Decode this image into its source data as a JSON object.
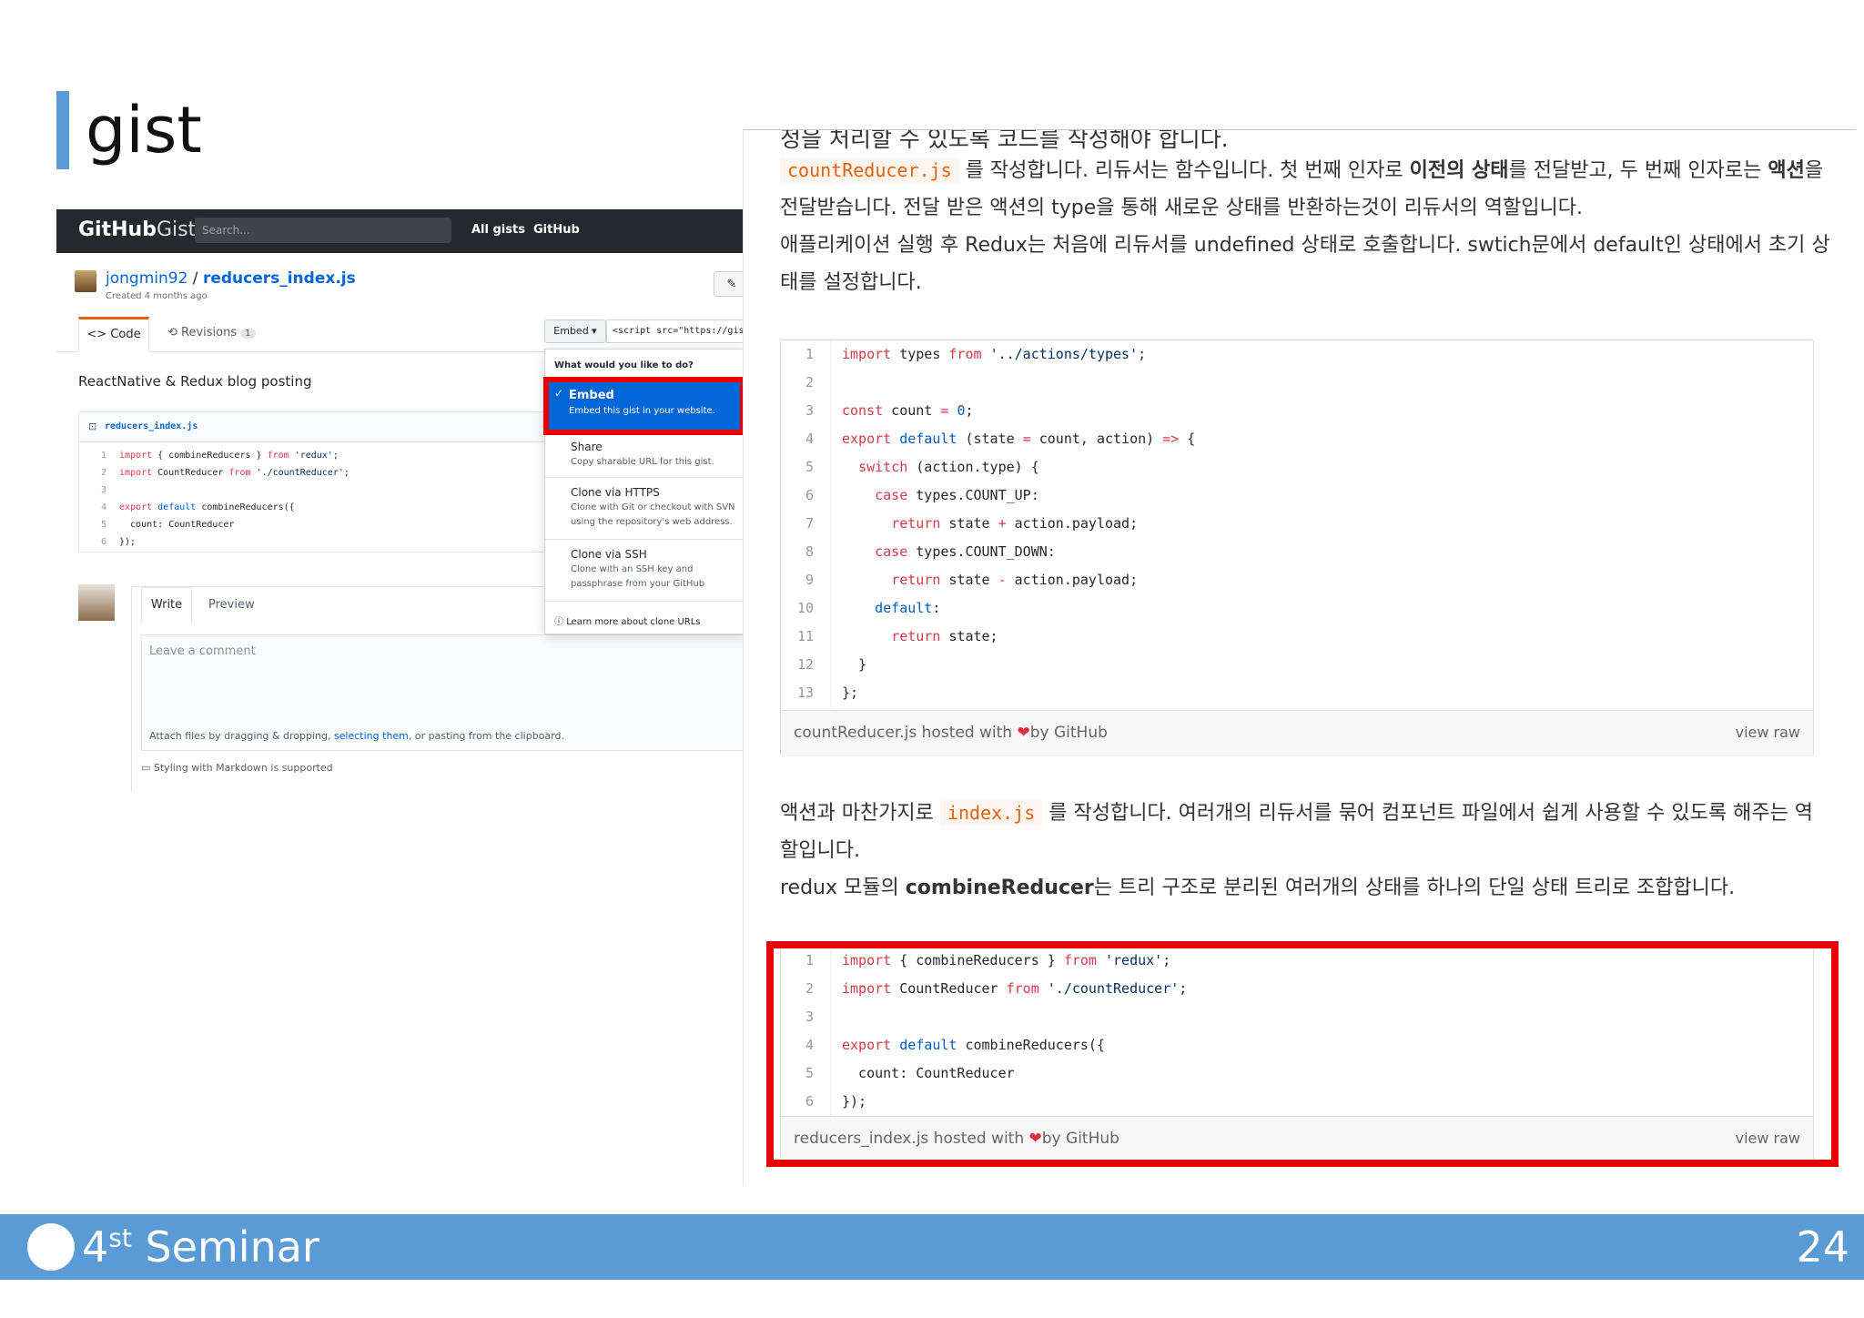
{
  "slide": {
    "title": "gist",
    "footer_label": "Seminar",
    "footer_num": "4",
    "footer_sup": "st",
    "page_number": "24"
  },
  "gist": {
    "logo_bold": "GitHub",
    "logo_light": "Gist",
    "search_placeholder": "Search...",
    "nav": [
      "All gists",
      "GitHub"
    ],
    "owner": "jongmin92",
    "separator": " / ",
    "file_title": "reducers_index.js",
    "created": "Created 4 months ago",
    "tab_code": "<> Code",
    "tab_revisions": "Revisions",
    "revision_count": "1",
    "embed_button": "Embed ▾",
    "embed_url": "<script src=\"https://gist",
    "description": "ReactNative & Redux blog posting",
    "file_name": "reducers_index.js",
    "snippet": [
      {
        "n": "1",
        "t": "import { combineReducers } from 'redux';"
      },
      {
        "n": "2",
        "t": "import CountReducer from './countReducer';"
      },
      {
        "n": "3",
        "t": ""
      },
      {
        "n": "4",
        "t": "export default combineReducers({"
      },
      {
        "n": "5",
        "t": "  count: CountReducer"
      },
      {
        "n": "6",
        "t": "});"
      }
    ],
    "comment": {
      "tab_write": "Write",
      "tab_preview": "Preview",
      "placeholder": "Leave a comment",
      "attach_pre": "Attach files by dragging & dropping, ",
      "attach_link": "selecting them",
      "attach_post": ", or pasting from the clipboard.",
      "markdown": "Styling with Markdown is supported"
    },
    "dropdown": {
      "header": "What would you like to do?",
      "embed_title": "Embed",
      "embed_desc": "Embed this gist in your website.",
      "share_title": "Share",
      "share_desc": "Copy sharable URL for this gist.",
      "https_title": "Clone via HTTPS",
      "https_desc": "Clone with Git or checkout with SVN using the repository's web address.",
      "ssh_title": "Clone via SSH",
      "ssh_desc": "Clone with an SSH key and passphrase from your GitHub settings.",
      "learn": "Learn more about clone URLs"
    }
  },
  "blog": {
    "cut_line": "정을 처리할 수 있도록 코드를 작성해야 합니다.",
    "p1_code": "countReducer.js",
    "p1_a": " 를 작성합니다. 리듀서는 함수입니다. 첫 번째 인자로 ",
    "p1_b": "이전의 상태",
    "p1_c": "를 전달받고, 두 번째 인자로는 ",
    "p1_d": "액션",
    "p1_e": "을",
    "p2": "전달받습니다. 전달 받은 액션의 type을 통해 새로운 상태를 반환하는것이 리듀서의 역할입니다.",
    "p3": "애플리케이션 실행 후 Redux는 처음에 리듀서를 undefined 상태로 호출합니다. swtich문에서 default인 상태에서 초기 상",
    "p4": "태를 설정합니다.",
    "code1": [
      {
        "n": "1",
        "t": "import types from '../actions/types';"
      },
      {
        "n": "2",
        "t": ""
      },
      {
        "n": "3",
        "t": "const count = 0;"
      },
      {
        "n": "4",
        "t": "export default (state = count, action) => {"
      },
      {
        "n": "5",
        "t": "  switch (action.type) {"
      },
      {
        "n": "6",
        "t": "    case types.COUNT_UP:"
      },
      {
        "n": "7",
        "t": "      return state + action.payload;"
      },
      {
        "n": "8",
        "t": "    case types.COUNT_DOWN:"
      },
      {
        "n": "9",
        "t": "      return state - action.payload;"
      },
      {
        "n": "10",
        "t": "    default:"
      },
      {
        "n": "11",
        "t": "      return state;"
      },
      {
        "n": "12",
        "t": "  }"
      },
      {
        "n": "13",
        "t": "};"
      }
    ],
    "code1_footer": "countReducer.js hosted with ",
    "footer_by": "by GitHub",
    "view_raw": "view raw",
    "p5_a": "액션과 마찬가지로 ",
    "p5_code": "index.js",
    "p5_b": " 를 작성합니다. 여러개의 리듀서를 묶어 컴포넌트 파일에서 쉽게 사용할 수 있도록 해주는 역",
    "p6": "할입니다.",
    "p7_a": "redux 모듈의 ",
    "p7_b": "combineReducer",
    "p7_c": "는 트리 구조로 분리된 여러개의 상태를 하나의 단일 상태 트리로 조합합니다.",
    "code2": [
      {
        "n": "1",
        "t": "import { combineReducers } from 'redux';"
      },
      {
        "n": "2",
        "t": "import CountReducer from './countReducer';"
      },
      {
        "n": "3",
        "t": ""
      },
      {
        "n": "4",
        "t": "export default combineReducers({"
      },
      {
        "n": "5",
        "t": "  count: CountReducer"
      },
      {
        "n": "6",
        "t": "});"
      }
    ],
    "code2_footer": "reducers_index.js hosted with "
  },
  "colors": {
    "accent_blue": "#5b9bd5",
    "highlight_red": "#e60000",
    "github_dark": "#24292e",
    "link_blue": "#0366d6"
  }
}
